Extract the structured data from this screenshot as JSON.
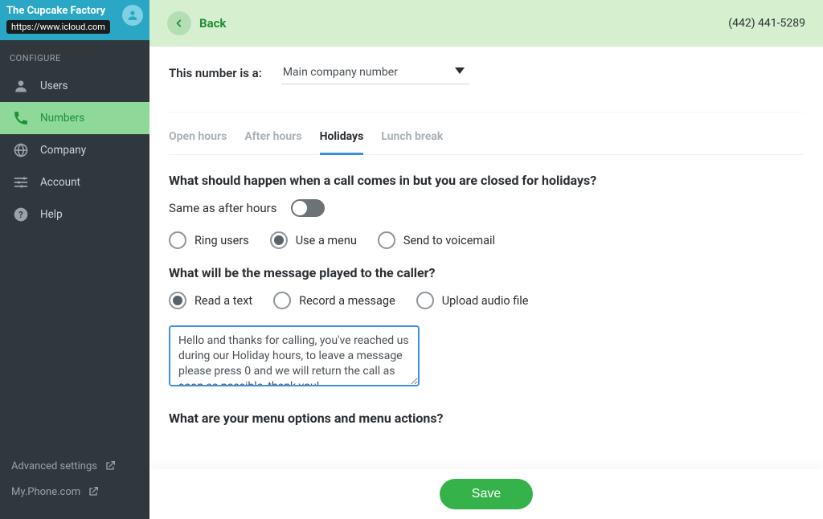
{
  "brand": {
    "title": "The Cupcake Factory",
    "url": "https://www.icloud.com"
  },
  "sidebar": {
    "section": "CONFIGURE",
    "items": [
      {
        "label": "Users",
        "icon": "user"
      },
      {
        "label": "Numbers",
        "icon": "phone",
        "active": true
      },
      {
        "label": "Company",
        "icon": "globe"
      },
      {
        "label": "Account",
        "icon": "sliders"
      },
      {
        "label": "Help",
        "icon": "help"
      }
    ],
    "footer": {
      "advanced": "Advanced settings",
      "myphone": "My.Phone.com"
    }
  },
  "header": {
    "back_label": "Back",
    "phone": "(442) 441-5289"
  },
  "numtype": {
    "label": "This number is a:",
    "value": "Main company number"
  },
  "tabs": [
    {
      "label": "Open hours"
    },
    {
      "label": "After hours"
    },
    {
      "label": "Holidays",
      "active": true
    },
    {
      "label": "Lunch break"
    }
  ],
  "holidays": {
    "q1": "What should happen when a call comes in but you are closed for holidays?",
    "same_as_after": "Same as after hours",
    "action_options": [
      {
        "label": "Ring users",
        "checked": false
      },
      {
        "label": "Use a menu",
        "checked": true
      },
      {
        "label": "Send to voicemail",
        "checked": false
      }
    ],
    "q2": "What will be the message played to the caller?",
    "message_options": [
      {
        "label": "Read a text",
        "checked": true
      },
      {
        "label": "Record a message",
        "checked": false
      },
      {
        "label": "Upload audio file",
        "checked": false
      }
    ],
    "message_text": "Hello and thanks for calling, you've reached us during our Holiday hours, to leave a message please press 0 and we will return the call as soon as possible, thank you!",
    "q3": "What are your menu options and menu actions?"
  },
  "save_label": "Save"
}
